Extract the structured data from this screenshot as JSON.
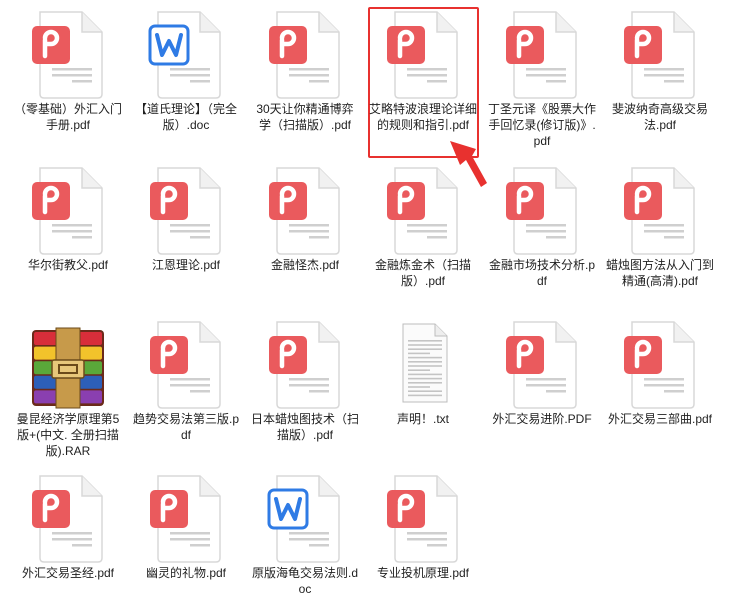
{
  "files": [
    {
      "name": "（零基础）外汇入门手册.pdf",
      "type": "pdf"
    },
    {
      "name": "【道氏理论】（完全版）.doc",
      "type": "doc"
    },
    {
      "name": "30天让你精通博弈学（扫描版）.pdf",
      "type": "pdf"
    },
    {
      "name": "艾略特波浪理论详细的规则和指引.pdf",
      "type": "pdf",
      "highlighted": true
    },
    {
      "name": "丁圣元译《股票大作手回忆录(修订版)》.pdf",
      "type": "pdf"
    },
    {
      "name": "斐波纳奇高级交易法.pdf",
      "type": "pdf"
    },
    {
      "name": "华尔街教父.pdf",
      "type": "pdf"
    },
    {
      "name": "江恩理论.pdf",
      "type": "pdf"
    },
    {
      "name": "金融怪杰.pdf",
      "type": "pdf"
    },
    {
      "name": "金融炼金术（扫描版）.pdf",
      "type": "pdf"
    },
    {
      "name": "金融市场技术分析.pdf",
      "type": "pdf"
    },
    {
      "name": "蜡烛图方法从入门到精通(高清).pdf",
      "type": "pdf"
    },
    {
      "name": "曼昆经济学原理第5版+(中文. 全册扫描版).RAR",
      "type": "rar"
    },
    {
      "name": "趋势交易法第三版.pdf",
      "type": "pdf"
    },
    {
      "name": "日本蜡烛图技术（扫描版）.pdf",
      "type": "pdf"
    },
    {
      "name": "声明！.txt",
      "type": "txt"
    },
    {
      "name": "外汇交易进阶.PDF",
      "type": "pdf"
    },
    {
      "name": "外汇交易三部曲.pdf",
      "type": "pdf"
    },
    {
      "name": "外汇交易圣经.pdf",
      "type": "pdf"
    },
    {
      "name": "幽灵的礼物.pdf",
      "type": "pdf"
    },
    {
      "name": "原版海龟交易法则.doc",
      "type": "doc"
    },
    {
      "name": "专业投机原理.pdf",
      "type": "pdf"
    }
  ],
  "colors": {
    "pdf_badge": "#ea5a5d",
    "doc_badge": "#2f7be5",
    "highlight": "#e8312f",
    "rar_stripes": [
      "#d82e3a",
      "#f2c32b",
      "#5aa83a",
      "#2d5fb8",
      "#8a3fb0"
    ]
  }
}
